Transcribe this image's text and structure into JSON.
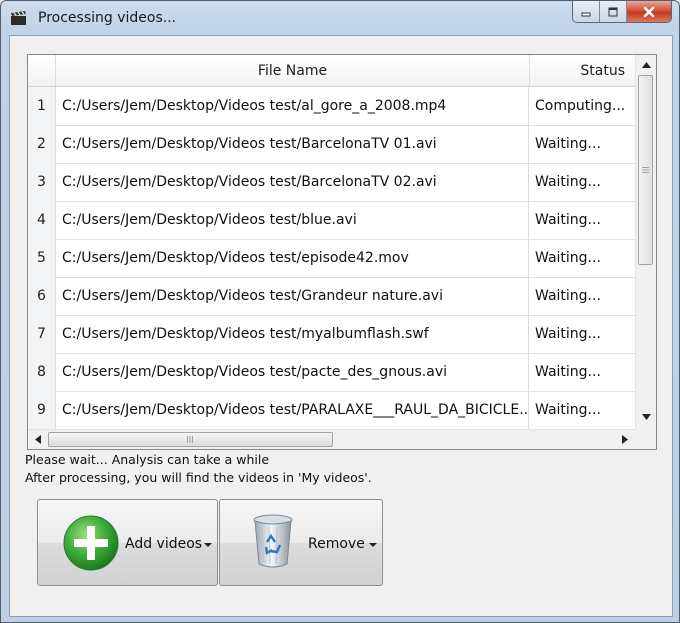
{
  "window": {
    "title": "Processing videos..."
  },
  "table": {
    "columns": [
      "",
      "File Name",
      "Status"
    ],
    "rows": [
      {
        "num": "1",
        "file": "C:/Users/Jem/Desktop/Videos test/al_gore_a_2008.mp4",
        "status": "Computing..."
      },
      {
        "num": "2",
        "file": "C:/Users/Jem/Desktop/Videos test/BarcelonaTV 01.avi",
        "status": "Waiting..."
      },
      {
        "num": "3",
        "file": "C:/Users/Jem/Desktop/Videos test/BarcelonaTV 02.avi",
        "status": "Waiting..."
      },
      {
        "num": "4",
        "file": "C:/Users/Jem/Desktop/Videos test/blue.avi",
        "status": "Waiting..."
      },
      {
        "num": "5",
        "file": "C:/Users/Jem/Desktop/Videos test/episode42.mov",
        "status": "Waiting..."
      },
      {
        "num": "6",
        "file": "C:/Users/Jem/Desktop/Videos test/Grandeur nature.avi",
        "status": "Waiting..."
      },
      {
        "num": "7",
        "file": "C:/Users/Jem/Desktop/Videos test/myalbumflash.swf",
        "status": "Waiting..."
      },
      {
        "num": "8",
        "file": "C:/Users/Jem/Desktop/Videos test/pacte_des_gnous.avi",
        "status": "Waiting..."
      },
      {
        "num": "9",
        "file": "C:/Users/Jem/Desktop/Videos test/PARALAXE___RAUL_DA_BICICLE...",
        "status": "Waiting..."
      }
    ]
  },
  "messages": {
    "line1": "Please wait... Analysis can take a while",
    "line2": "After processing, you will find the videos in 'My videos'."
  },
  "buttons": {
    "add_label": "Add videos",
    "remove_label": "Remove"
  },
  "colors": {
    "add_icon": "#3aa83a",
    "title_bar": "#c0d3e8",
    "close_button": "#c8432a"
  }
}
